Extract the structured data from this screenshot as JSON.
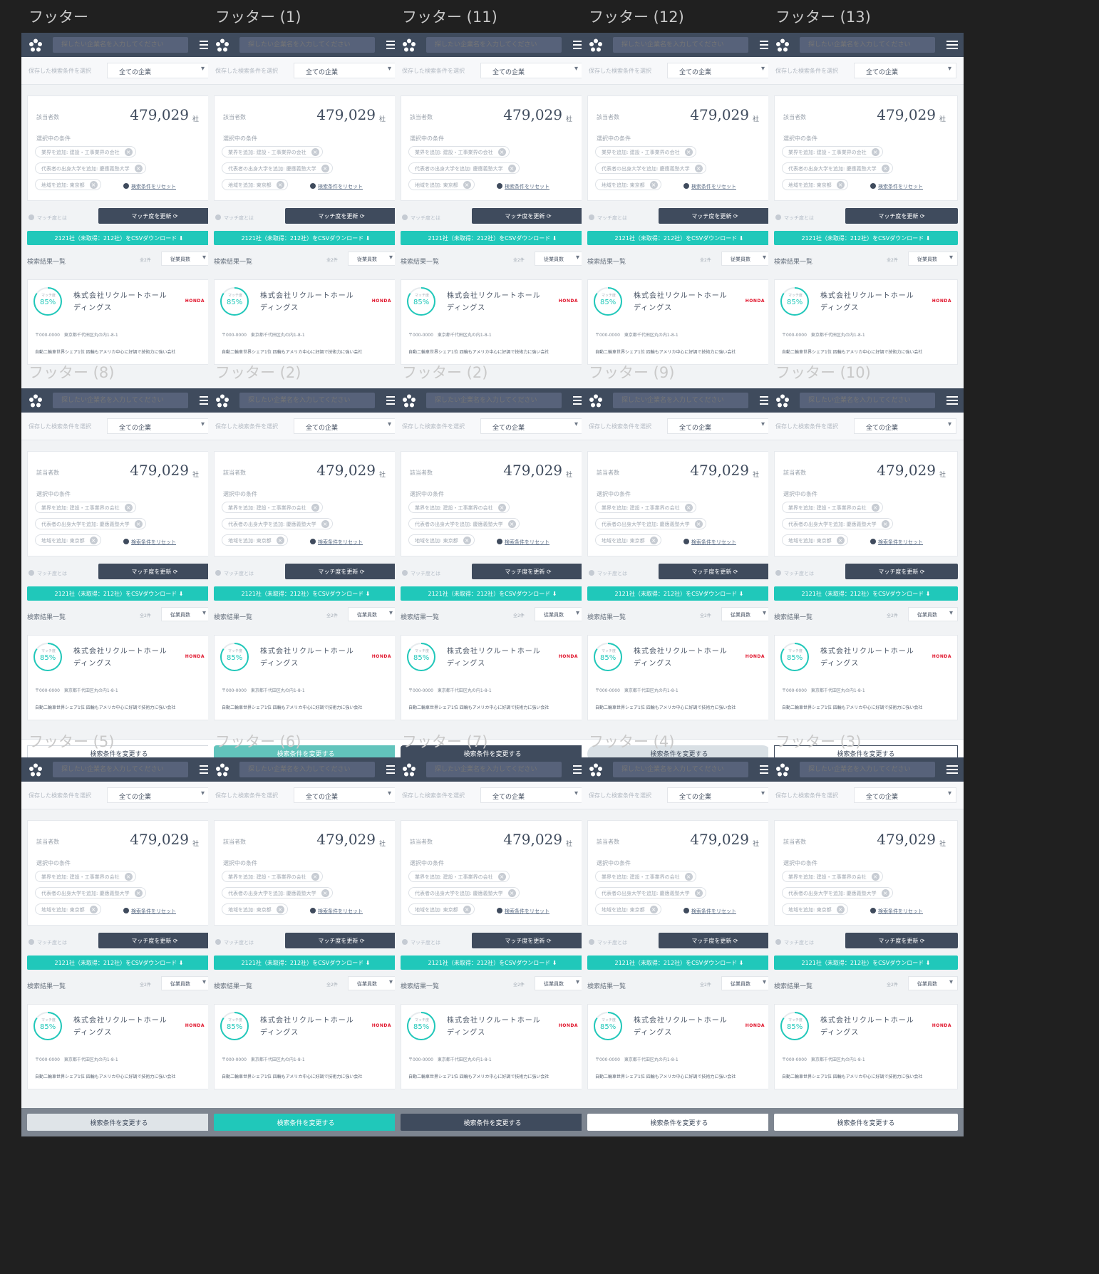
{
  "screen": {
    "search_placeholder": "探したい企業名を入力してください",
    "saved_label": "保存した検索条件を選択",
    "saved_value": "全ての企業",
    "count_label": "該当者数",
    "count_value": "479,029",
    "count_unit": "社",
    "conditions_label": "選択中の条件",
    "chips": [
      "業界を追加: 建設・工事業界の会社",
      "代表者の出身大学を追加: 慶應義塾大学",
      "地域を追加: 東京都"
    ],
    "reset_label": "検索条件をリセット",
    "match_help": "マッチ度とは",
    "update_button": "マッチ度を更新",
    "csv_button": "2121社（未取得：212社）をCSVダウンロード",
    "results_title": "検索結果一覧",
    "results_count": "全2件",
    "sort_value": "従業員数",
    "match_caption": "マッチ度",
    "match_value": "85%",
    "match_fraction": 0.85,
    "company_name": "株式会社リクルートホールディングス",
    "company_logo": "HONDA",
    "address": "〒000-0000　東京都千代田区丸の内1-8-1",
    "description": "自動二輪車世界シェア1位 四輪もアメリカ中心に好調で技術力に強い会社",
    "footer_button": "検索条件を変更する"
  },
  "frames": [
    {
      "title": "フッター",
      "footer_style": "grey"
    },
    {
      "title": "フッター (1)",
      "footer_style": "teal"
    },
    {
      "title": "フッター (11)",
      "footer_style": "navy"
    },
    {
      "title": "フッター (12)",
      "footer_style": "pale"
    },
    {
      "title": "フッター (13)",
      "footer_style": "white"
    },
    {
      "title": "フッター (8)",
      "footer_style": "card-white"
    },
    {
      "title": "フッター (2)",
      "footer_style": "card-teal"
    },
    {
      "title": "フッター (2)",
      "footer_style": "card-navy"
    },
    {
      "title": "フッター (9)",
      "footer_style": "card-pill"
    },
    {
      "title": "フッター (10)",
      "footer_style": "card-outline"
    },
    {
      "title": "フッター (5)",
      "footer_style": "dark-pale"
    },
    {
      "title": "フッター (6)",
      "footer_style": "dark-teal"
    },
    {
      "title": "フッター (7)",
      "footer_style": "dark-navy"
    },
    {
      "title": "フッター (4)",
      "footer_style": "dark-white"
    },
    {
      "title": "フッター (3)",
      "footer_style": "dark-white"
    }
  ],
  "colors": {
    "canvas": "#202020",
    "navy": "#3f4b5d",
    "teal": "#20c8ba",
    "brand_red": "#e0132a"
  }
}
